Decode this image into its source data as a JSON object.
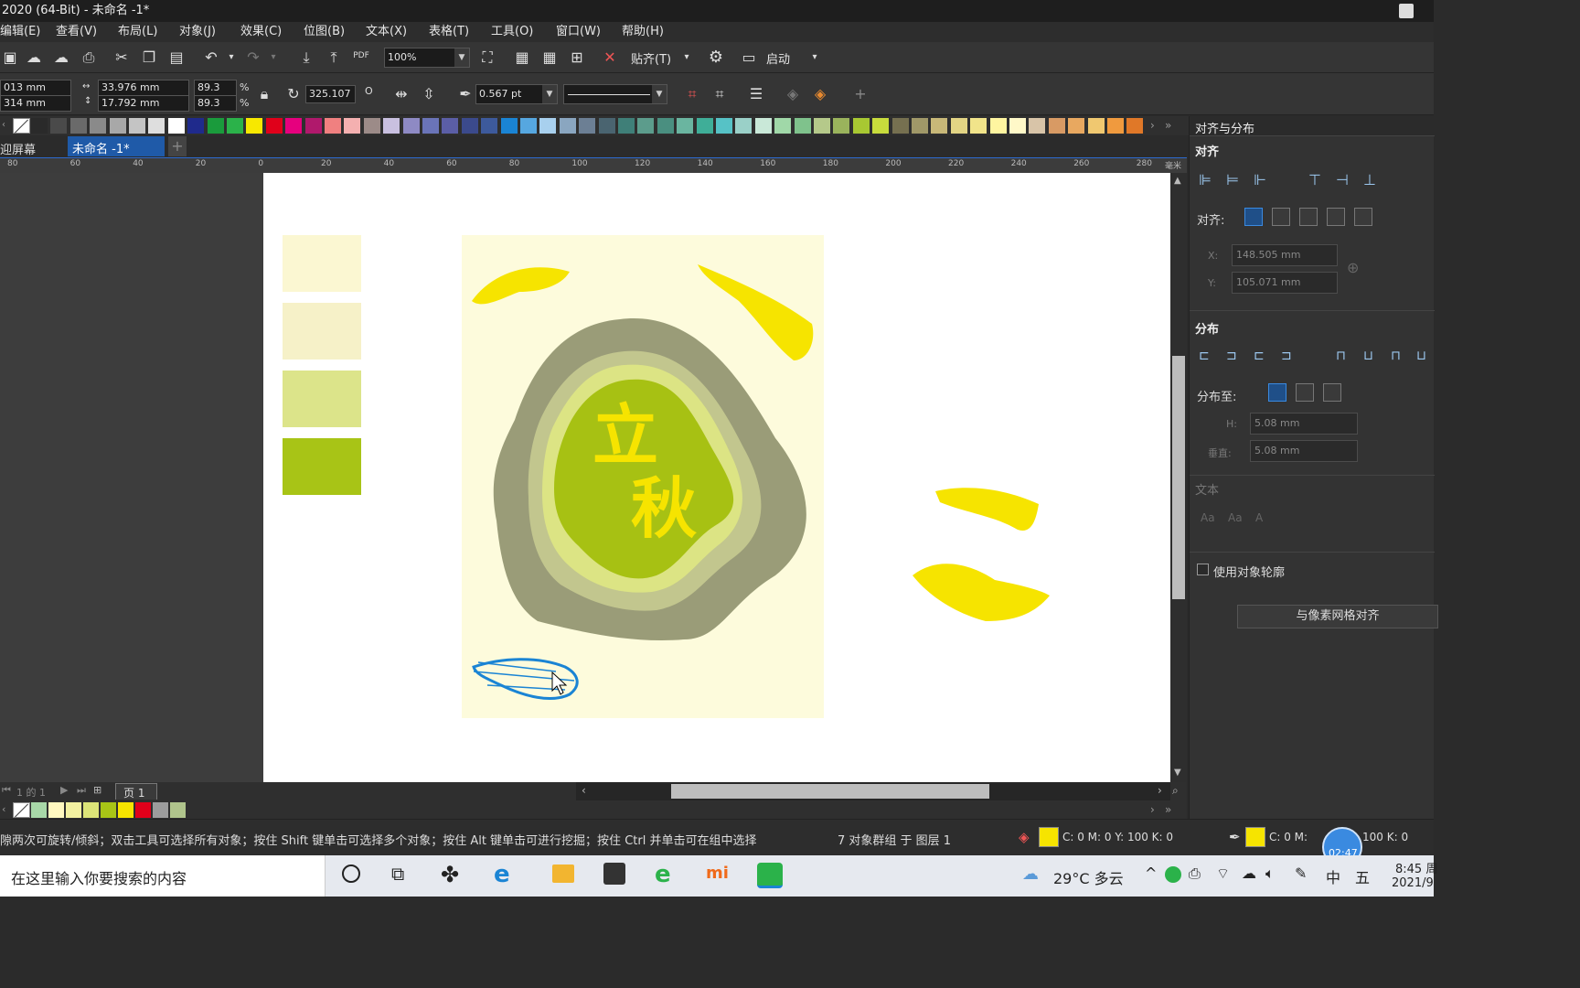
{
  "window": {
    "title": "2020 (64-Bit) - 未命名 -1*",
    "user_icon": "user-account-icon"
  },
  "menu": [
    {
      "label": "编辑(E)"
    },
    {
      "label": "查看(V)"
    },
    {
      "label": "布局(L)"
    },
    {
      "label": "对象(J)"
    },
    {
      "label": "效果(C)"
    },
    {
      "label": "位图(B)"
    },
    {
      "label": "文本(X)"
    },
    {
      "label": "表格(T)"
    },
    {
      "label": "工具(O)"
    },
    {
      "label": "窗口(W)"
    },
    {
      "label": "帮助(H)"
    }
  ],
  "toolbar": {
    "zoom_value": "100%",
    "snap_label": "贴齐(T)",
    "launch_label": "启动",
    "pdf_label": "PDF"
  },
  "property_bar": {
    "x_value": "013 mm",
    "y_value": "314 mm",
    "width_value": "33.976 mm",
    "height_value": "17.792 mm",
    "scale_x": "89.3",
    "scale_y": "89.3",
    "percent": "%",
    "rotation_value": "325.107",
    "degree_mark": "O",
    "outline_width": "0.567 pt"
  },
  "palette_colors": [
    "#2a2a2a",
    "#4a4a4a",
    "#6a6a6a",
    "#8a8a8a",
    "#a8a8a8",
    "#c4c4c4",
    "#dedede",
    "#ffffff",
    "#1f2a8c",
    "#1a9b3c",
    "#2bb24a",
    "#f7e800",
    "#e0001a",
    "#e6007e",
    "#b0196c",
    "#f08080",
    "#f4b0b0",
    "#9c8b88",
    "#c9c0e0",
    "#8e8ac4",
    "#6a74b8",
    "#5b5ea6",
    "#3b4a8c",
    "#3d5a9c",
    "#1a84d4",
    "#56a7e0",
    "#a8d0ee",
    "#8aa6c0",
    "#6c7f94",
    "#4a6470",
    "#3f7f78",
    "#5c9c8c",
    "#4a8f80",
    "#6ab5a0",
    "#3fae98",
    "#56c2c6",
    "#9ad0c8",
    "#c9e8d8",
    "#a0d8a8",
    "#7fc28c",
    "#b5c98a",
    "#9ab35c",
    "#a8c832",
    "#c8dc3c",
    "#767050",
    "#a09868",
    "#c8b878",
    "#e2d484",
    "#f1e48a",
    "#fff5a0",
    "#fff8c8",
    "#d8c4a8",
    "#d89a64",
    "#e8a860",
    "#f0c870",
    "#f09a3e",
    "#e07828"
  ],
  "doc_tabs": [
    {
      "label": "迎屏幕"
    },
    {
      "label": "未命名 -1*"
    }
  ],
  "ruler_ticks": [
    "80",
    "60",
    "40",
    "20",
    "0",
    "20",
    "40",
    "60",
    "80",
    "100",
    "120",
    "140",
    "160",
    "180",
    "200",
    "220",
    "240",
    "260",
    "280"
  ],
  "ruler_unit": "毫米",
  "artwork": {
    "text_top": "立",
    "text_bottom": "秋",
    "text_color": "#f6e400",
    "background": "#fdfbdc",
    "swatches": [
      "#fbf7d2",
      "#f6f1c8",
      "#dce48a",
      "#a8c416"
    ],
    "layers": [
      "#9a9c78",
      "#c2c68e",
      "#dce484",
      "#a7c113"
    ]
  },
  "pagebar": {
    "page_count_text": "1 的 1",
    "page_tab": "页 1"
  },
  "doc_palette": [
    "#a8d8a8",
    "#fff8c0",
    "#f2f0a0",
    "#dce478",
    "#a8c416",
    "#f6e400",
    "#e0001a",
    "#9c9c9c",
    "#b0c48c"
  ],
  "status": {
    "hint": "隙两次可旋转/倾斜；双击工具可选择所有对象；按住 Shift 键单击可选择多个对象；按住 Alt 键单击可进行挖掘；按住 Ctrl 并单击可在组中选择",
    "selection": "7 对象群组 于 图层 1",
    "fill_cmyk": "C: 0 M: 0 Y: 100 K: 0",
    "outline_cmyk": "C: 0 M:",
    "outline_k": "100 K: 0",
    "fill_color": "#f6e400"
  },
  "docker": {
    "title": "对齐与分布",
    "align_section": "对齐",
    "align_to_label": "对齐:",
    "x_label": "X:",
    "x_value": "148.505 mm",
    "y_label": "Y:",
    "y_value": "105.071 mm",
    "distribute_section": "分布",
    "distribute_to_label": "分布至:",
    "h_label": "H:",
    "h_value": "5.08 mm",
    "v_label": "垂直:",
    "v_value": "5.08 mm",
    "text_section": "文本",
    "outline_checkbox": "使用对象轮廓",
    "pixel_grid_button": "与像素网格对齐"
  },
  "taskbar": {
    "search_placeholder": "在这里输入你要搜索的内容",
    "weather": "29°C 多云",
    "ime": "中",
    "ime2": "五",
    "time": "8:45 周",
    "date": "2021/9",
    "timer": "02:47"
  }
}
